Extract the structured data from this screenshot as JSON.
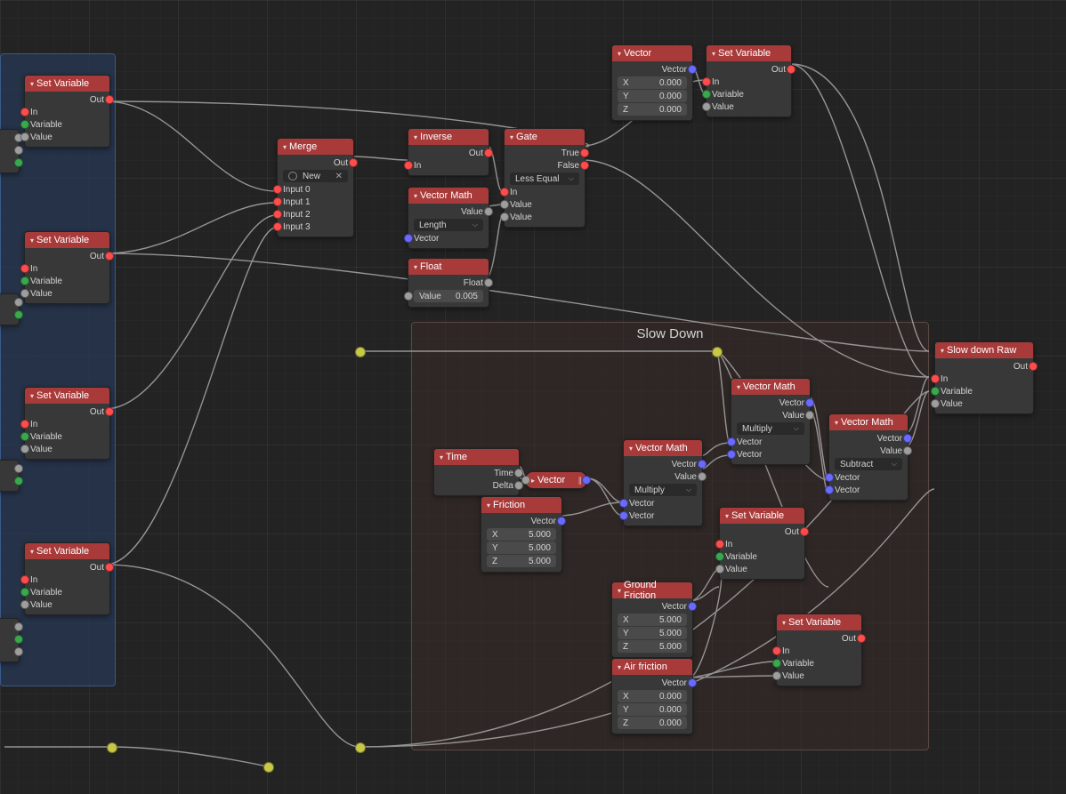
{
  "frames": {
    "blue": {},
    "brown": {
      "title": "Slow Down"
    }
  },
  "nodes": {
    "setvar": {
      "title": "Set Variable",
      "out": "Out",
      "in": "In",
      "variable": "Variable",
      "value": "Value"
    },
    "merge": {
      "title": "Merge",
      "out": "Out",
      "new": "New",
      "inputs": [
        "Input 0",
        "Input 1",
        "Input 2",
        "Input 3"
      ]
    },
    "inverse": {
      "title": "Inverse",
      "out": "Out",
      "in": "In"
    },
    "gate": {
      "title": "Gate",
      "true": "True",
      "false": "False",
      "op": "Less Equal",
      "in": "In",
      "value": "Value",
      "value2": "Value"
    },
    "vectormath": {
      "title": "Vector Math",
      "value": "Value",
      "vector": "Vector",
      "length": "Length",
      "multiply": "Multiply",
      "subtract": "Subtract"
    },
    "float": {
      "title": "Float",
      "float": "Float",
      "value": "Value",
      "num": "0.005"
    },
    "vector": {
      "title": "Vector",
      "vector": "Vector",
      "x": "X",
      "y": "Y",
      "z": "Z",
      "zero": "0.000"
    },
    "time": {
      "title": "Time",
      "time": "Time",
      "delta": "Delta"
    },
    "friction": {
      "title": "Friction",
      "vector": "Vector",
      "x": "X",
      "y": "Y",
      "z": "Z",
      "five": "5.000"
    },
    "gfriction": {
      "title": "Ground Friction",
      "vector": "Vector",
      "x": "X",
      "y": "Y",
      "z": "Z",
      "five": "5.000"
    },
    "afriction": {
      "title": "Air friction",
      "vector": "Vector",
      "x": "X",
      "y": "Y",
      "z": "Z",
      "zero": "0.000"
    },
    "slowraw": {
      "title": "Slow down Raw",
      "out": "Out",
      "in": "In",
      "variable": "Variable",
      "value": "Value"
    },
    "vecroute": {
      "label": "Vector"
    }
  }
}
